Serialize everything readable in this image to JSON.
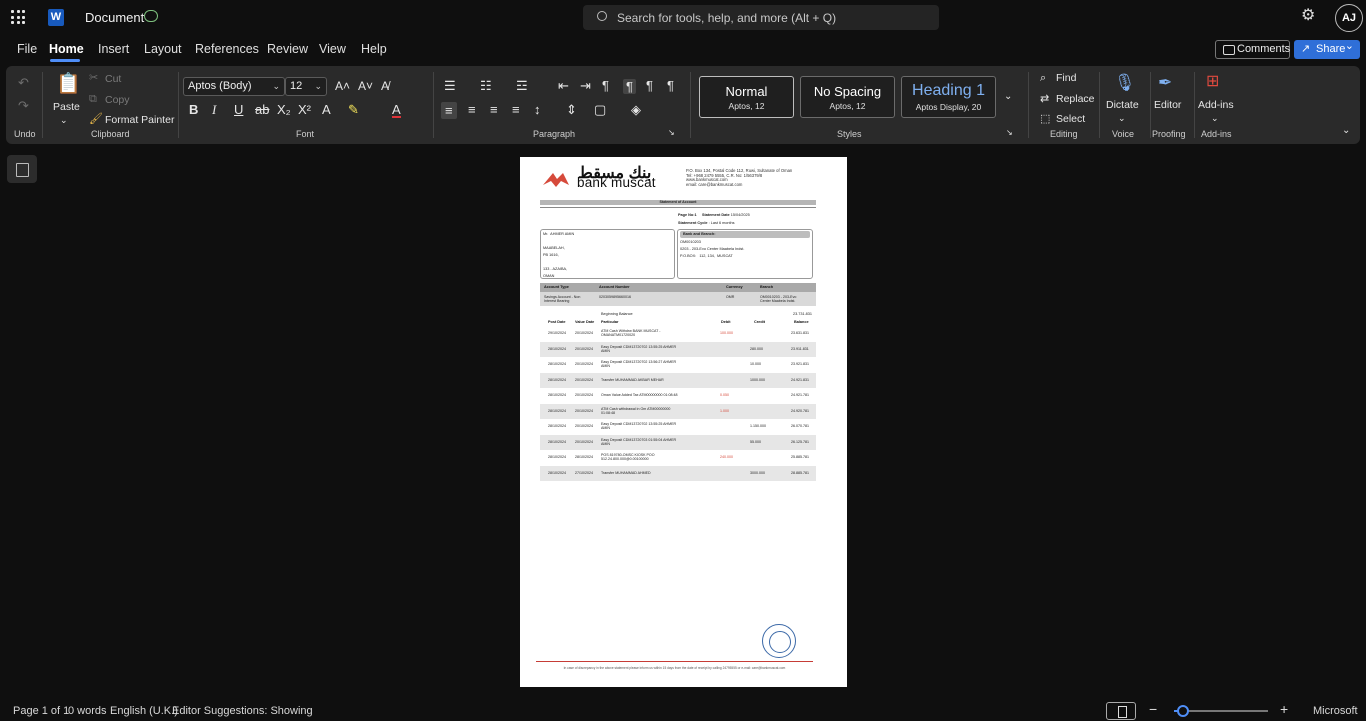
{
  "titlebar": {
    "doc_title": "Document",
    "search_placeholder": "Search for tools, help, and more (Alt + Q)",
    "avatar_initials": "AJ"
  },
  "menu": {
    "items": [
      "File",
      "Home",
      "Insert",
      "Layout",
      "References",
      "Review",
      "View",
      "Help"
    ],
    "active": "Home",
    "comments_label": "Comments",
    "share_label": "Share"
  },
  "ribbon": {
    "undo_label": "Undo",
    "clipboard": {
      "paste": "Paste",
      "cut": "Cut",
      "copy": "Copy",
      "format_painter": "Format Painter",
      "group": "Clipboard"
    },
    "font": {
      "family": "Aptos (Body)",
      "size": "12",
      "group": "Font"
    },
    "paragraph": {
      "group": "Paragraph"
    },
    "styles": {
      "group": "Styles",
      "cards": [
        {
          "name": "Normal",
          "sub": "Aptos, 12"
        },
        {
          "name": "No Spacing",
          "sub": "Aptos, 12"
        },
        {
          "name": "Heading 1",
          "sub": "Aptos Display, 20"
        }
      ]
    },
    "editing": {
      "find": "Find",
      "replace": "Replace",
      "select": "Select",
      "group": "Editing"
    },
    "voice": {
      "dictate": "Dictate",
      "group": "Voice"
    },
    "proofing": {
      "editor": "Editor",
      "group": "Proofing"
    },
    "addins": {
      "addins": "Add-ins",
      "group": "Add-ins"
    }
  },
  "statement": {
    "bank_ar": "بنك مسقط",
    "bank_en": "bank muscat",
    "address": [
      "P.O. Box 134, Postal Code 112, Ruwi, Sultanate of Oman",
      "Tel: +968 2479 5555, C.R. No: 1/56379/8",
      "www.bankmuscat.com",
      "email: care@bankmuscat.com"
    ],
    "title": "Statement of Account",
    "page_no_label": "Page No:",
    "page_no": "1",
    "statement_date_label": "Statement Date",
    "statement_date": "15/04/2025",
    "cycle_label": "Statement Cycle",
    "cycle": ": Last 6 months",
    "customer_lines": "Mr.  AHMER AMIN\n\nMAABELAH,\nPB 1616,\n\n133 - AZAIBA,\nOMAN",
    "branch_head": "Bank and Branch:",
    "branch_lines": "OM0010203\n0203 - 203-Evo Center Maabela Indst.\nP.O.BOX:   112, 134,  MUSCAT",
    "acct_headers": [
      "Account Type",
      "Account Number",
      "Currency",
      "Branch"
    ],
    "acct_values": [
      "Savings Account - Non\nInterest Bearing",
      "0203059895660016",
      "OMR",
      "OM0010203 - 203-Evo\nCenter Maabela Indst."
    ],
    "opening_label": "Beginning Balance",
    "opening_value": "23.731.831",
    "table_headers": [
      "Post Date",
      "Value Date",
      "Particular",
      "Debit",
      "Credit",
      "Balance"
    ],
    "rows": [
      {
        "post": "29/10/2024",
        "value": "20/10/2024",
        "particular": "ATM Cash Withdrw BANK MUSCAT -\nOMANATM01720020",
        "debit": "100.000",
        "credit": "",
        "balance": "23.631.831"
      },
      {
        "post": "28/10/2024",
        "value": "20/10/2024",
        "particular": "Easy Deposit CDM13720702 13:55:25 AHMER\nAMIN",
        "debit": "",
        "credit": "280.000",
        "balance": "23.911.831"
      },
      {
        "post": "28/10/2024",
        "value": "20/10/2024",
        "particular": "Easy Deposit CDM13720702 13:56:27 AHMER\nAMIN",
        "debit": "",
        "credit": "10.000",
        "balance": "23.921.831"
      },
      {
        "post": "28/10/2024",
        "value": "20/10/2024",
        "particular": "Transfer MUHAMMAD AKBAR MEHAR",
        "debit": "",
        "credit": "1000.000",
        "balance": "24.921.831"
      },
      {
        "post": "28/10/2024",
        "value": "20/10/2024",
        "particular": "Oman Value Added Tax ATM00000000 01:08:48",
        "debit": "0.050",
        "credit": "",
        "balance": "24.921.781"
      },
      {
        "post": "28/10/2024",
        "value": "20/10/2024",
        "particular": "ATM Cash withdrawal in Om ATM00000000\n01:08:48",
        "debit": "1.000",
        "credit": "",
        "balance": "24.920.781"
      },
      {
        "post": "28/10/2024",
        "value": "20/10/2024",
        "particular": "Easy Deposit CDM13720702 13:55:25 AHMER\nAMIN",
        "debit": "",
        "credit": "1.150.000",
        "balance": "26.070.781"
      },
      {
        "post": "28/10/2024",
        "value": "20/10/2024",
        "particular": "Easy Deposit CDM13720703 01:55:04 AHMER\nAMIN",
        "debit": "",
        "credit": "55.000",
        "balance": "26.125.781"
      },
      {
        "post": "28/10/2024",
        "value": "28/10/2024",
        "particular": "POS 819780-OMSC KIOSK POO\n512.24.800.000@0.00100000",
        "debit": "240.000",
        "credit": "",
        "balance": "25.885.781"
      },
      {
        "post": "28/10/2024",
        "value": "27/10/2024",
        "particular": "Transfer MUHAMMAD AHMED",
        "debit": "",
        "credit": "3000.000",
        "balance": "28.885.781"
      }
    ],
    "footer": "In case of discrepancy in the above statement please inform us within 15 days from the date of receipt by calling 24795555 or e-mail: care@bankmuscat.com"
  },
  "status": {
    "page": "Page 1 of 1",
    "words": "0 words",
    "language": "English (U.K.)",
    "suggestions": "Editor Suggestions: Showing",
    "zoom_fraction": 0.1,
    "brand": "Microsoft"
  },
  "colors": {
    "accent": "#4f8ef7",
    "share": "#2f6fd8",
    "bank_red": "#d64a3b"
  }
}
